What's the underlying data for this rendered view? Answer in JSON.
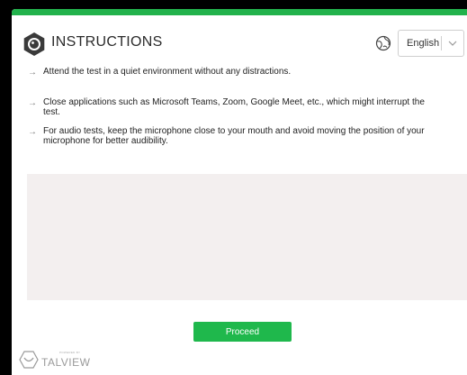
{
  "header": {
    "title": "INSTRUCTIONS",
    "language": {
      "selected": "English"
    }
  },
  "instructions": [
    {
      "text": "Attend the test in a quiet environment without any distractions."
    },
    {
      "text": "Close applications such as Microsoft Teams, Zoom, Google Meet, etc., which might interrupt the test."
    },
    {
      "text": "For audio tests, keep the microphone close to your mouth and avoid moving the position of your microphone for better audibility."
    }
  ],
  "actions": {
    "proceed_label": "Proceed"
  },
  "footer": {
    "powered_by": "POWERED BY",
    "brand": "TALVIEW"
  },
  "colors": {
    "accent": "#22b24c",
    "button": "#1fb84c",
    "panel": "#f3efef"
  },
  "icons": [
    "microphone-logo-icon",
    "globe-icon",
    "chevron-down-icon",
    "arrow-right-icon",
    "talview-logo-icon"
  ]
}
